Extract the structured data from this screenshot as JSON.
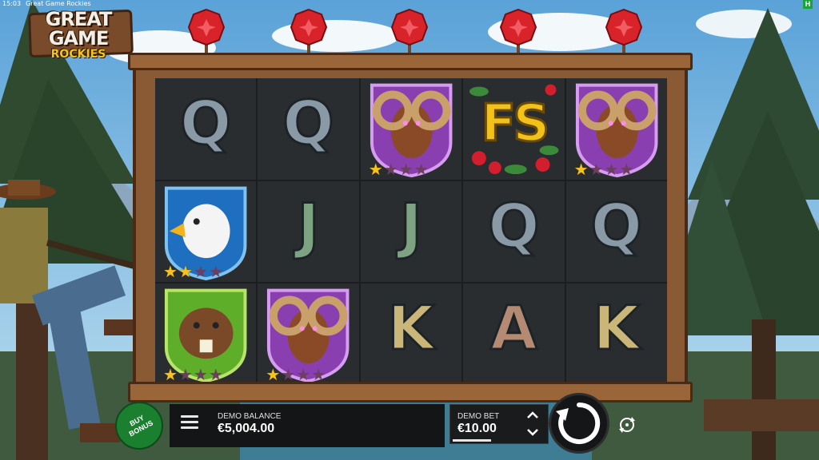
{
  "status_bar": {
    "time": "15:03",
    "title": "Great Game Rockies",
    "badge": "H"
  },
  "logo": {
    "line1": "GREAT GAME",
    "line2": "ROCKIES"
  },
  "colors": {
    "accent_green": "#1a7f2e",
    "target_red": "#d8232a",
    "star_on": "#f6c31c",
    "frame_wood": "#8a5a34"
  },
  "reels": [
    [
      {
        "symbol": "Q",
        "type": "letter"
      },
      {
        "symbol": "eagle",
        "type": "animal",
        "stars": 2
      },
      {
        "symbol": "beaver",
        "type": "animal",
        "stars": 1
      }
    ],
    [
      {
        "symbol": "Q",
        "type": "letter"
      },
      {
        "symbol": "J",
        "type": "letter"
      },
      {
        "symbol": "ram",
        "type": "animal",
        "stars": 1
      }
    ],
    [
      {
        "symbol": "ram",
        "type": "animal",
        "stars": 1
      },
      {
        "symbol": "J",
        "type": "letter"
      },
      {
        "symbol": "K",
        "type": "letter"
      }
    ],
    [
      {
        "symbol": "FS",
        "type": "scatter"
      },
      {
        "symbol": "Q",
        "type": "letter"
      },
      {
        "symbol": "A",
        "type": "letter"
      }
    ],
    [
      {
        "symbol": "ram",
        "type": "animal",
        "stars": 1
      },
      {
        "symbol": "Q",
        "type": "letter"
      },
      {
        "symbol": "K",
        "type": "letter"
      }
    ]
  ],
  "max_stars": 4,
  "buy_bonus": {
    "label": "BUY BONUS"
  },
  "balance": {
    "label": "DEMO BALANCE",
    "value": "€5,004.00"
  },
  "bet": {
    "label": "DEMO BET",
    "value": "€10.00"
  },
  "icons": {
    "menu": "hamburger-icon",
    "spin": "spin-arrow-icon",
    "autoplay": "autoplay-icon",
    "bet_up": "chevron-up-icon",
    "bet_down": "chevron-down-icon",
    "target": "target-icon"
  }
}
